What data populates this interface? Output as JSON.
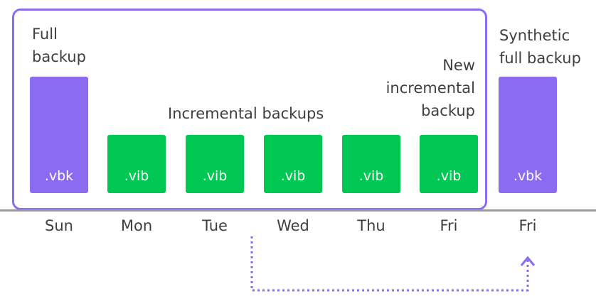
{
  "labels": {
    "full_backup": "Full\nbackup",
    "synthetic_full_backup": "Synthetic\nfull backup",
    "new_incremental_backup": "New\nincremental\nbackup",
    "incremental_backups": "Incremental backups"
  },
  "blocks": {
    "full": ".vbk",
    "inc1": ".vib",
    "inc2": ".vib",
    "inc3": ".vib",
    "inc4": ".vib",
    "inc5": ".vib",
    "synthetic": ".vbk"
  },
  "days": [
    "Sun",
    "Mon",
    "Tue",
    "Wed",
    "Thu",
    "Fri",
    "Fri"
  ],
  "colors": {
    "full": "#8b6cf0",
    "incremental": "#00c853",
    "frame": "#8b6cf0",
    "baseline": "#9b9b9b"
  }
}
